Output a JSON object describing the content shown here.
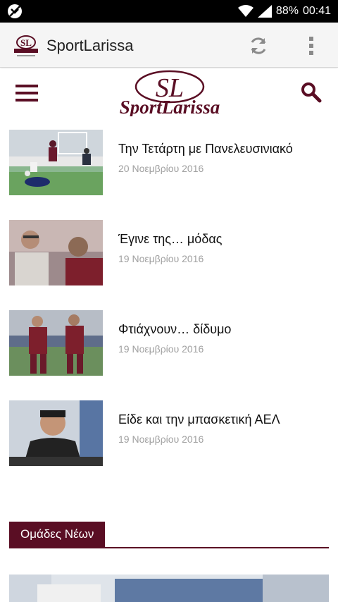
{
  "status_bar": {
    "battery": "88%",
    "time": "00:41"
  },
  "app_bar": {
    "title": "SportLarissa"
  },
  "site_header": {
    "logo_big": "SL",
    "logo_text": "SportLarissa"
  },
  "articles": [
    {
      "title": "Την Τετάρτη με Πανελευσινιακό",
      "date": "20 Νοεμβρίου 2016"
    },
    {
      "title": "Έγινε της… μόδας",
      "date": "19 Νοεμβρίου 2016"
    },
    {
      "title": "Φτιάχνουν… δίδυμο",
      "date": "19 Νοεμβρίου 2016"
    },
    {
      "title": "Είδε και την μπασκετική ΑΕΛ",
      "date": "19 Νοεμβρίου 2016"
    }
  ],
  "section": {
    "title": "Ομάδες Νέων"
  },
  "colors": {
    "brand": "#5a0e24",
    "status_bar": "#000000"
  }
}
